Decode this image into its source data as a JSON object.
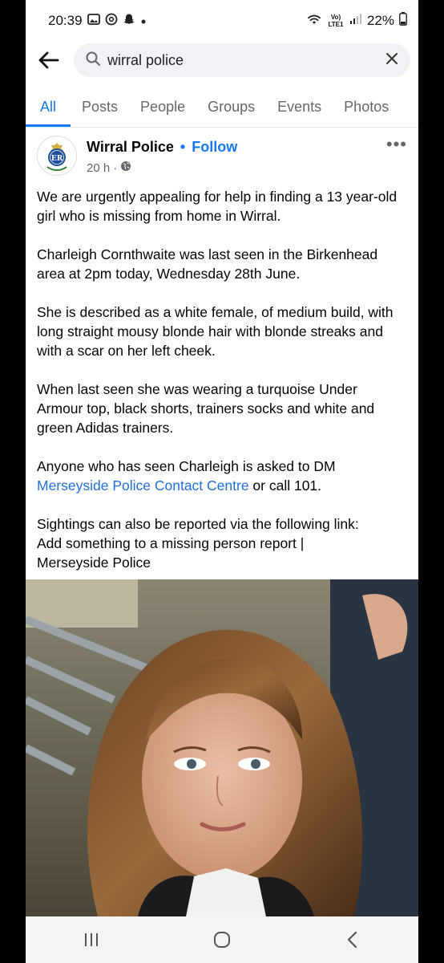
{
  "status_bar": {
    "time": "20:39",
    "network": "Vo) LTE1",
    "battery": "22%"
  },
  "search": {
    "query": "wirral police"
  },
  "tabs": [
    "All",
    "Posts",
    "People",
    "Groups",
    "Events",
    "Photos"
  ],
  "post": {
    "author": "Wirral Police",
    "follow_label": "Follow",
    "separator": "•",
    "time": "20 h ·",
    "avatar_text": "ER",
    "more_label": "•••",
    "paragraphs": {
      "p1": "We are urgently appealing for help in finding a 13 year-old girl who is missing from home in Wirral.",
      "p2": "Charleigh Cornthwaite was last seen in the Birkenhead area at 2pm today, Wednesday 28th June.",
      "p3": "She is described as a white female, of medium build, with long straight mousy blonde hair with blonde streaks and with a scar on her left cheek.",
      "p4": "When last seen she was wearing a turquoise Under Armour top, black shorts, trainers socks and white and green Adidas trainers.",
      "p5_prefix": "Anyone who has seen Charleigh is asked to DM ",
      "p5_link": "Merseyside Police Contact Centre",
      "p5_suffix": " or call 101.",
      "p6_line1": "Sightings can also be reported via the following link:",
      "p6_line2": "Add something to a missing person report |",
      "p6_line3": "Merseyside Police"
    }
  },
  "colors": {
    "accent": "#1877f2",
    "link": "#216fdb",
    "text": "#050505",
    "muted": "#65676b"
  }
}
